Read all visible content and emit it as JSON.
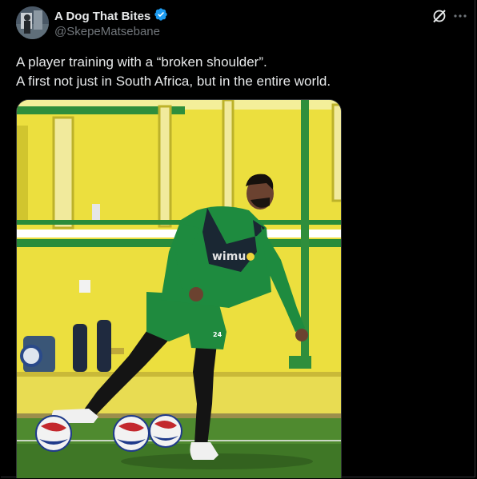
{
  "author": {
    "display_name": "A Dog That Bites",
    "handle": "@SkepeMatsebane",
    "verified": true,
    "verified_color": "#1d9bf0"
  },
  "tweet": {
    "lines": [
      "A player training with a “broken shoulder”.",
      "A first not just in South Africa, but in the entire world."
    ]
  },
  "media": {
    "bib_text": "wimu",
    "shorts_number": "24"
  },
  "icons": {
    "grok": "grok-icon",
    "more": "more-options-icon"
  }
}
